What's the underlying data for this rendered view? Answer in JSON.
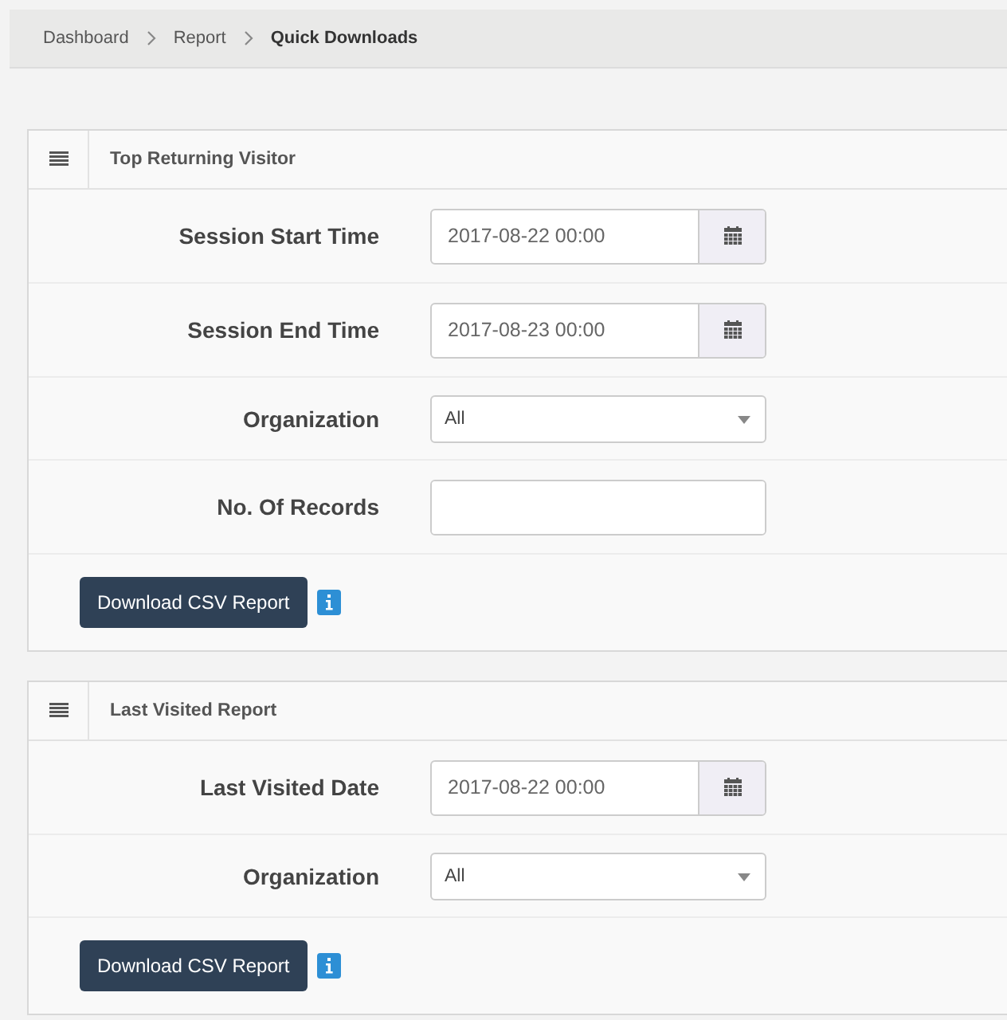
{
  "breadcrumb": [
    {
      "label": "Dashboard",
      "current": false
    },
    {
      "label": "Report",
      "current": false
    },
    {
      "label": "Quick Downloads",
      "current": true
    }
  ],
  "panels": [
    {
      "title": "Top Returning Visitor",
      "fields": [
        {
          "kind": "date",
          "label": "Session Start Time",
          "value": "2017-08-22 00:00"
        },
        {
          "kind": "date",
          "label": "Session End Time",
          "value": "2017-08-23 00:00"
        },
        {
          "kind": "select",
          "label": "Organization",
          "value": "All"
        },
        {
          "kind": "text",
          "label": "No. Of Records"
        }
      ],
      "button": "Download CSV Report"
    },
    {
      "title": "Last Visited Report",
      "fields": [
        {
          "kind": "date",
          "label": "Last Visited Date",
          "value": "2017-08-22 00:00"
        },
        {
          "kind": "select",
          "label": "Organization",
          "value": "All"
        }
      ],
      "button": "Download CSV Report"
    }
  ]
}
